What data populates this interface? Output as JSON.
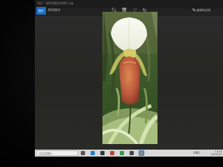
{
  "window": {
    "title": "照片 - 绿色背景花卉图片.jpg",
    "app_name": "照片",
    "breadcrumb": "所有照片"
  },
  "toolbar": {
    "icons": [
      "zoom-icon",
      "delete-icon",
      "favorite-icon",
      "rotate-icon"
    ],
    "right_label": "编辑和创建"
  },
  "image": {
    "subject": "slipper orchid"
  },
  "taskbar": {
    "search_placeholder": "在这里输入",
    "tray_text": "ENG",
    "time": "10:24",
    "date": "2019/3/2"
  },
  "colors": {
    "accent": "#1a6fc9",
    "viewer_bg": "#262722"
  }
}
